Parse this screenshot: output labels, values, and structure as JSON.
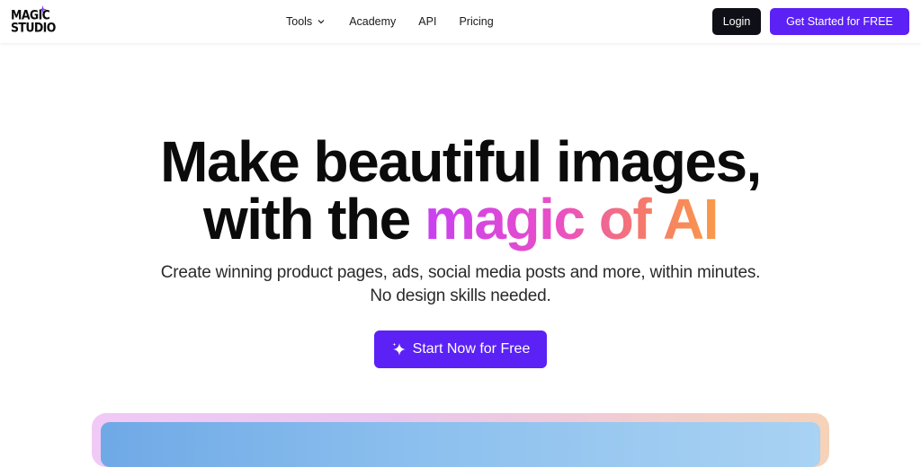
{
  "brand": {
    "logo_line1": "MAGIC",
    "logo_line2": "STUDIO",
    "accent_color": "#5b21f5"
  },
  "nav": {
    "items": [
      {
        "label": "Tools",
        "icon": "chevron-down-icon"
      },
      {
        "label": "Academy"
      },
      {
        "label": "API"
      },
      {
        "label": "Pricing"
      }
    ],
    "login_label": "Login",
    "get_started_label": "Get Started for FREE"
  },
  "hero": {
    "title_line1": "Make beautiful images,",
    "title_line2_plain": "with the ",
    "title_line2_gradient": "magic of AI",
    "subtitle_line1": "Create winning product pages, ads, social media posts and more, within minutes.",
    "subtitle_line2": "No design skills needed.",
    "cta_label": "Start Now for Free",
    "cta_icon": "sparkle-icon"
  }
}
